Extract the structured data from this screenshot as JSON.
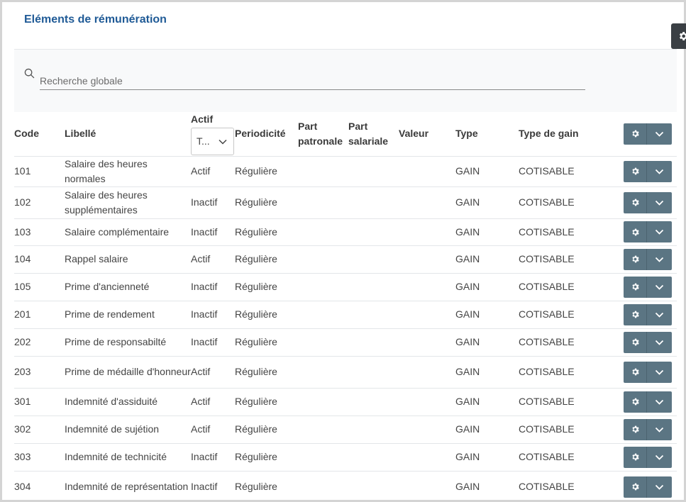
{
  "page": {
    "title": "Eléments de rémunération"
  },
  "search": {
    "placeholder": "Recherche globale",
    "value": ""
  },
  "table": {
    "headers": {
      "code": "Code",
      "libelle": "Libellé",
      "actif": "Actif",
      "actif_filter": "T...",
      "periodicite": "Periodicité",
      "part_patronale": "Part patronale",
      "part_salariale": "Part salariale",
      "valeur": "Valeur",
      "type": "Type",
      "type_gain": "Type de gain"
    },
    "rows": [
      {
        "code": "101",
        "libelle": "Salaire des heures normales",
        "actif": "Actif",
        "periodicite": "Régulière",
        "part_patronale": "",
        "part_salariale": "",
        "valeur": "",
        "type": "GAIN",
        "type_gain": "COTISABLE"
      },
      {
        "code": "102",
        "libelle": "Salaire des heures supplémentaires",
        "actif": "Inactif",
        "periodicite": "Régulière",
        "part_patronale": "",
        "part_salariale": "",
        "valeur": "",
        "type": "GAIN",
        "type_gain": "COTISABLE"
      },
      {
        "code": "103",
        "libelle": "Salaire complémentaire",
        "actif": "Inactif",
        "periodicite": "Régulière",
        "part_patronale": "",
        "part_salariale": "",
        "valeur": "",
        "type": "GAIN",
        "type_gain": "COTISABLE"
      },
      {
        "code": "104",
        "libelle": "Rappel salaire",
        "actif": "Actif",
        "periodicite": "Régulière",
        "part_patronale": "",
        "part_salariale": "",
        "valeur": "",
        "type": "GAIN",
        "type_gain": "COTISABLE"
      },
      {
        "code": "105",
        "libelle": "Prime d'ancienneté",
        "actif": "Inactif",
        "periodicite": "Régulière",
        "part_patronale": "",
        "part_salariale": "",
        "valeur": "",
        "type": "GAIN",
        "type_gain": "COTISABLE"
      },
      {
        "code": "201",
        "libelle": "Prime de rendement",
        "actif": "Inactif",
        "periodicite": "Régulière",
        "part_patronale": "",
        "part_salariale": "",
        "valeur": "",
        "type": "GAIN",
        "type_gain": "COTISABLE"
      },
      {
        "code": "202",
        "libelle": "Prime de responsabilté",
        "actif": "Inactif",
        "periodicite": "Régulière",
        "part_patronale": "",
        "part_salariale": "",
        "valeur": "",
        "type": "GAIN",
        "type_gain": "COTISABLE"
      },
      {
        "code": "203",
        "libelle": "Prime de médaille d'honneur",
        "actif": "Actif",
        "periodicite": "Régulière",
        "part_patronale": "",
        "part_salariale": "",
        "valeur": "",
        "type": "GAIN",
        "type_gain": "COTISABLE"
      },
      {
        "code": "301",
        "libelle": "Indemnité d'assiduité",
        "actif": "Actif",
        "periodicite": "Régulière",
        "part_patronale": "",
        "part_salariale": "",
        "valeur": "",
        "type": "GAIN",
        "type_gain": "COTISABLE"
      },
      {
        "code": "302",
        "libelle": "Indemnité de sujétion",
        "actif": "Actif",
        "periodicite": "Régulière",
        "part_patronale": "",
        "part_salariale": "",
        "valeur": "",
        "type": "GAIN",
        "type_gain": "COTISABLE"
      },
      {
        "code": "303",
        "libelle": "Indemnité de technicité",
        "actif": "Inactif",
        "periodicite": "Régulière",
        "part_patronale": "",
        "part_salariale": "",
        "valeur": "",
        "type": "GAIN",
        "type_gain": "COTISABLE"
      },
      {
        "code": "304",
        "libelle": "Indemnité de représentation",
        "actif": "Inactif",
        "periodicite": "Régulière",
        "part_patronale": "",
        "part_salariale": "",
        "valeur": "",
        "type": "GAIN",
        "type_gain": "COTISABLE"
      }
    ]
  },
  "icons": {
    "row_settings": "gear-icon",
    "row_menu": "chevron-down-icon",
    "search": "search-icon",
    "side_panel": "gear-icon"
  },
  "colors": {
    "title": "#1f5a96",
    "button": "#5b7583",
    "side_tab": "#3a3f44"
  }
}
